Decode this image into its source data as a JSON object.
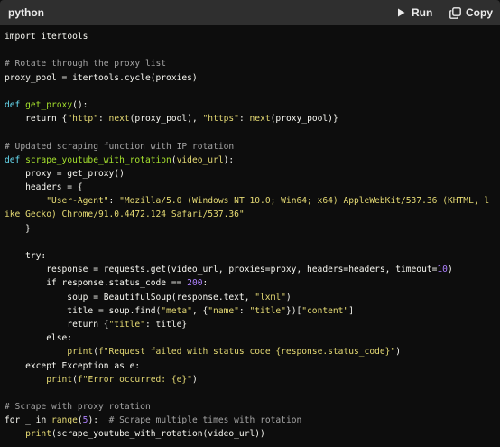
{
  "header": {
    "language": "python",
    "run_label": "Run",
    "copy_label": "Copy"
  },
  "code_lines": [
    [
      {
        "t": "import ",
        "c": "id"
      },
      {
        "t": "itertools",
        "c": "id"
      }
    ],
    [],
    [
      {
        "t": "# Rotate through the proxy list",
        "c": "com"
      }
    ],
    [
      {
        "t": "proxy_pool = itertools.cycle(proxies)",
        "c": "id"
      }
    ],
    [],
    [
      {
        "t": "def ",
        "c": "kw2"
      },
      {
        "t": "get_proxy",
        "c": "fn"
      },
      {
        "t": "():",
        "c": "id"
      }
    ],
    [
      {
        "t": "    return ",
        "c": "id"
      },
      {
        "t": "{",
        "c": "id"
      },
      {
        "t": "\"http\"",
        "c": "str"
      },
      {
        "t": ": ",
        "c": "id"
      },
      {
        "t": "next",
        "c": "bi"
      },
      {
        "t": "(proxy_pool), ",
        "c": "id"
      },
      {
        "t": "\"https\"",
        "c": "str"
      },
      {
        "t": ": ",
        "c": "id"
      },
      {
        "t": "next",
        "c": "bi"
      },
      {
        "t": "(proxy_pool)}",
        "c": "id"
      }
    ],
    [],
    [
      {
        "t": "# Updated scraping function with IP rotation",
        "c": "com"
      }
    ],
    [
      {
        "t": "def ",
        "c": "kw2"
      },
      {
        "t": "scrape_youtube_with_rotation",
        "c": "fn"
      },
      {
        "t": "(",
        "c": "id"
      },
      {
        "t": "video_url",
        "c": "str"
      },
      {
        "t": "):",
        "c": "id"
      }
    ],
    [
      {
        "t": "    proxy = get_proxy()",
        "c": "id"
      }
    ],
    [
      {
        "t": "    headers = {",
        "c": "id"
      }
    ],
    [
      {
        "t": "        ",
        "c": "id"
      },
      {
        "t": "\"User-Agent\"",
        "c": "str"
      },
      {
        "t": ": ",
        "c": "id"
      },
      {
        "t": "\"Mozilla/5.0 (Windows NT 10.0; Win64; x64) AppleWebKit/537.36 (KHTML, l",
        "c": "str"
      }
    ],
    [
      {
        "t": "ike Gecko) Chrome/91.0.4472.124 Safari/537.36\"",
        "c": "str"
      }
    ],
    [
      {
        "t": "    }",
        "c": "id"
      }
    ],
    [],
    [
      {
        "t": "    try:",
        "c": "id"
      }
    ],
    [
      {
        "t": "        response = requests.get(video_url, proxies=proxy, headers=headers, timeout=",
        "c": "id"
      },
      {
        "t": "10",
        "c": "num"
      },
      {
        "t": ")",
        "c": "id"
      }
    ],
    [
      {
        "t": "        ",
        "c": "id"
      },
      {
        "t": "if ",
        "c": "id"
      },
      {
        "t": "response.status_code == ",
        "c": "id"
      },
      {
        "t": "200",
        "c": "num"
      },
      {
        "t": ":",
        "c": "id"
      }
    ],
    [
      {
        "t": "            soup = BeautifulSoup(response.text, ",
        "c": "id"
      },
      {
        "t": "\"lxml\"",
        "c": "str"
      },
      {
        "t": ")",
        "c": "id"
      }
    ],
    [
      {
        "t": "            title = soup.find(",
        "c": "id"
      },
      {
        "t": "\"meta\"",
        "c": "str"
      },
      {
        "t": ", {",
        "c": "id"
      },
      {
        "t": "\"name\"",
        "c": "str"
      },
      {
        "t": ": ",
        "c": "id"
      },
      {
        "t": "\"title\"",
        "c": "str"
      },
      {
        "t": "})[",
        "c": "id"
      },
      {
        "t": "\"content\"",
        "c": "str"
      },
      {
        "t": "]",
        "c": "id"
      }
    ],
    [
      {
        "t": "            return ",
        "c": "id"
      },
      {
        "t": "{",
        "c": "id"
      },
      {
        "t": "\"title\"",
        "c": "str"
      },
      {
        "t": ": title}",
        "c": "id"
      }
    ],
    [
      {
        "t": "        else:",
        "c": "id"
      }
    ],
    [
      {
        "t": "            ",
        "c": "id"
      },
      {
        "t": "print",
        "c": "bi"
      },
      {
        "t": "(",
        "c": "id"
      },
      {
        "t": "f\"Request failed with status code {response.status_code}\"",
        "c": "str"
      },
      {
        "t": ")",
        "c": "id"
      }
    ],
    [
      {
        "t": "    except ",
        "c": "id"
      },
      {
        "t": "Exception ",
        "c": "id"
      },
      {
        "t": "as ",
        "c": "id"
      },
      {
        "t": "e:",
        "c": "id"
      }
    ],
    [
      {
        "t": "        ",
        "c": "id"
      },
      {
        "t": "print",
        "c": "bi"
      },
      {
        "t": "(",
        "c": "id"
      },
      {
        "t": "f\"Error occurred: {e}\"",
        "c": "str"
      },
      {
        "t": ")",
        "c": "id"
      }
    ],
    [],
    [
      {
        "t": "# Scrape with proxy rotation",
        "c": "com"
      }
    ],
    [
      {
        "t": "for ",
        "c": "id"
      },
      {
        "t": "_ ",
        "c": "id"
      },
      {
        "t": "in ",
        "c": "id"
      },
      {
        "t": "range",
        "c": "bi"
      },
      {
        "t": "(",
        "c": "id"
      },
      {
        "t": "5",
        "c": "num"
      },
      {
        "t": "):  ",
        "c": "id"
      },
      {
        "t": "# Scrape multiple times with rotation",
        "c": "com"
      }
    ],
    [
      {
        "t": "    ",
        "c": "id"
      },
      {
        "t": "print",
        "c": "bi"
      },
      {
        "t": "(scrape_youtube_with_rotation(video_url))",
        "c": "id"
      }
    ]
  ],
  "colors": {
    "header_bg": "#2f2f2f",
    "code_bg": "#0d0d0d",
    "keyword": "#66d9ef",
    "function": "#a6e22e",
    "string": "#e6db74",
    "number": "#ae81ff",
    "comment": "#a5a5a5"
  }
}
